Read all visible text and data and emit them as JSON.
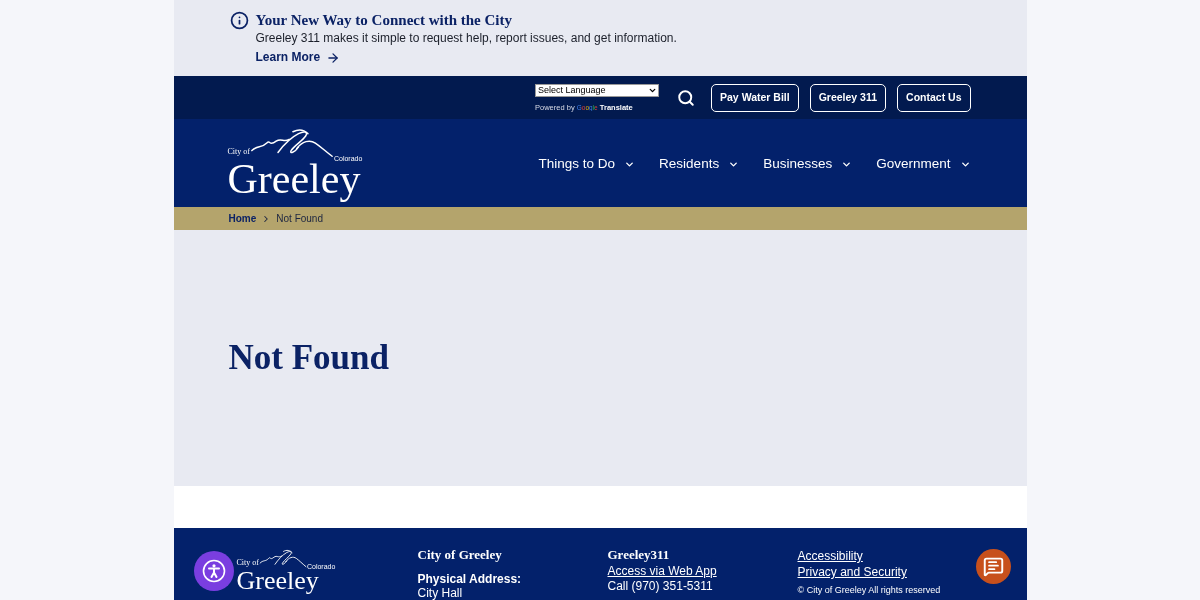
{
  "alert_banner": {
    "title": "Your New Way to Connect with the City",
    "text": "Greeley 311 makes it simple to request help, report issues, and get information.",
    "link": "Learn More"
  },
  "utility_bar": {
    "language_select": {
      "value": "Select Language"
    },
    "translate_credit": {
      "prefix": "Powered by",
      "brand": "Google",
      "product": "Translate"
    },
    "buttons": [
      "Pay Water Bill",
      "Greeley 311",
      "Contact Us"
    ]
  },
  "header": {
    "logo": {
      "prefix": "City of",
      "name": "Greeley",
      "region": "Colorado"
    },
    "nav": [
      "Things to Do",
      "Residents",
      "Businesses",
      "Government"
    ]
  },
  "breadcrumb": [
    {
      "label": "Home",
      "current": false
    },
    {
      "label": "Not Found",
      "current": true
    }
  ],
  "page": {
    "heading": "Not Found"
  },
  "footer": {
    "logo": {
      "prefix": "City of",
      "name": "Greeley",
      "region": "Colorado"
    },
    "columns": [
      {
        "heading": "City of Greeley",
        "items": [
          {
            "kind": "label",
            "text": "Physical Address:"
          },
          {
            "kind": "text",
            "text": "City Hall"
          }
        ]
      },
      {
        "heading": "Greeley311",
        "items": [
          {
            "kind": "link",
            "text": "Access via Web App"
          },
          {
            "kind": "text",
            "text": "Call (970) 351-5311"
          }
        ]
      },
      {
        "items": [
          {
            "kind": "link",
            "text": "Accessibility"
          },
          {
            "kind": "link",
            "text": "Privacy and Security"
          },
          {
            "kind": "note",
            "text": "© City of Greeley All rights reserved"
          }
        ]
      }
    ]
  }
}
